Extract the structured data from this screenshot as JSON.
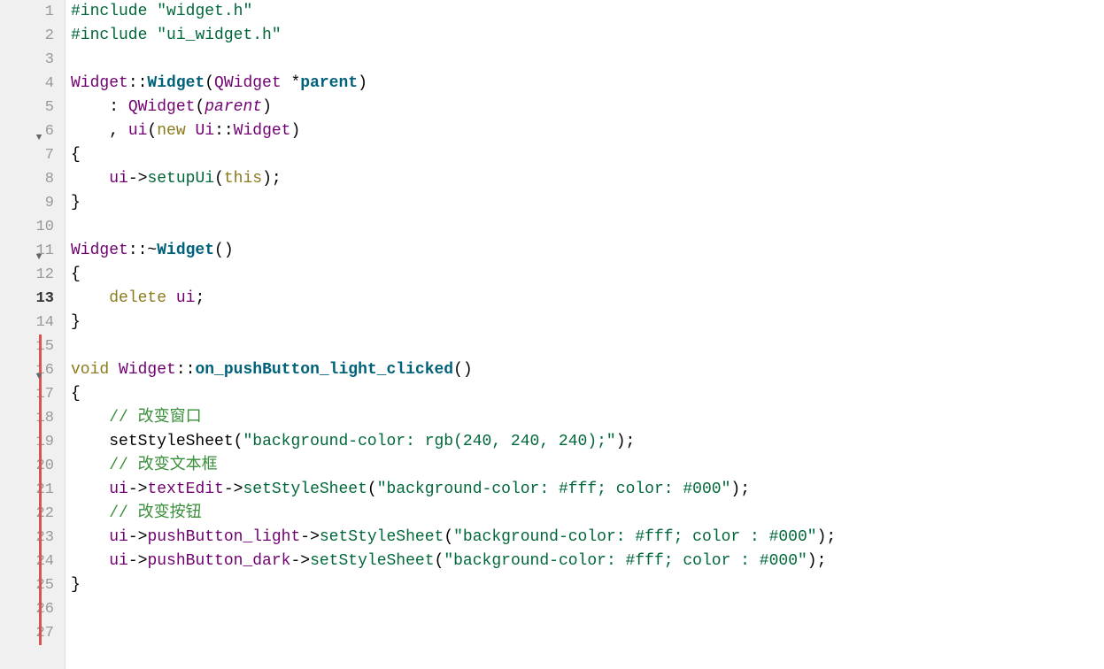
{
  "editor": {
    "current_line": 13,
    "lines": [
      {
        "num": 1,
        "tokens": [
          {
            "t": "#include",
            "c": "pp"
          },
          {
            "t": " "
          },
          {
            "t": "\"widget.h\"",
            "c": "str"
          }
        ]
      },
      {
        "num": 2,
        "tokens": [
          {
            "t": "#include",
            "c": "pp"
          },
          {
            "t": " "
          },
          {
            "t": "\"ui_widget.h\"",
            "c": "str"
          }
        ]
      },
      {
        "num": 3,
        "tokens": []
      },
      {
        "num": 4,
        "tokens": [
          {
            "t": "Widget",
            "c": "type"
          },
          {
            "t": "::"
          },
          {
            "t": "Widget",
            "c": "fn"
          },
          {
            "t": "("
          },
          {
            "t": "QWidget",
            "c": "type"
          },
          {
            "t": " *"
          },
          {
            "t": "parent",
            "c": "fn"
          },
          {
            "t": ")"
          }
        ]
      },
      {
        "num": 5,
        "tokens": [
          {
            "t": "    : "
          },
          {
            "t": "QWidget",
            "c": "type"
          },
          {
            "t": "("
          },
          {
            "t": "parent",
            "c": "param"
          },
          {
            "t": ")"
          }
        ]
      },
      {
        "num": 6,
        "fold": true,
        "tokens": [
          {
            "t": "    , "
          },
          {
            "t": "ui",
            "c": "id"
          },
          {
            "t": "("
          },
          {
            "t": "new",
            "c": "kw"
          },
          {
            "t": " "
          },
          {
            "t": "Ui",
            "c": "type"
          },
          {
            "t": "::"
          },
          {
            "t": "Widget",
            "c": "type"
          },
          {
            "t": ")"
          }
        ]
      },
      {
        "num": 7,
        "tokens": [
          {
            "t": "{"
          }
        ]
      },
      {
        "num": 8,
        "tokens": [
          {
            "t": "    "
          },
          {
            "t": "ui",
            "c": "id"
          },
          {
            "t": "->"
          },
          {
            "t": "setupUi",
            "c": "method"
          },
          {
            "t": "("
          },
          {
            "t": "this",
            "c": "kw"
          },
          {
            "t": ");"
          }
        ]
      },
      {
        "num": 9,
        "tokens": [
          {
            "t": "}"
          }
        ]
      },
      {
        "num": 10,
        "tokens": []
      },
      {
        "num": 11,
        "fold": true,
        "tokens": [
          {
            "t": "Widget",
            "c": "type"
          },
          {
            "t": "::~"
          },
          {
            "t": "Widget",
            "c": "fn"
          },
          {
            "t": "()"
          }
        ]
      },
      {
        "num": 12,
        "tokens": [
          {
            "t": "{"
          }
        ]
      },
      {
        "num": 13,
        "current": true,
        "tokens": [
          {
            "t": "    "
          },
          {
            "t": "delete",
            "c": "kw"
          },
          {
            "t": " "
          },
          {
            "t": "ui",
            "c": "id"
          },
          {
            "t": ";"
          }
        ]
      },
      {
        "num": 14,
        "tokens": [
          {
            "t": "}"
          }
        ]
      },
      {
        "num": 15,
        "changed": true,
        "tokens": []
      },
      {
        "num": 16,
        "changed": true,
        "fold": true,
        "tokens": [
          {
            "t": "void",
            "c": "kw"
          },
          {
            "t": " "
          },
          {
            "t": "Widget",
            "c": "type"
          },
          {
            "t": "::"
          },
          {
            "t": "on_pushButton_light_clicked",
            "c": "fn"
          },
          {
            "t": "()"
          }
        ]
      },
      {
        "num": 17,
        "changed": true,
        "tokens": [
          {
            "t": "{"
          }
        ]
      },
      {
        "num": 18,
        "changed": true,
        "tokens": [
          {
            "t": "    "
          },
          {
            "t": "// 改变窗口",
            "c": "comment"
          }
        ]
      },
      {
        "num": 19,
        "changed": true,
        "tokens": [
          {
            "t": "    "
          },
          {
            "t": "setStyleSheet"
          },
          {
            "t": "("
          },
          {
            "t": "\"background-color: rgb(240, 240, 240);\"",
            "c": "str"
          },
          {
            "t": ");"
          }
        ]
      },
      {
        "num": 20,
        "changed": true,
        "tokens": [
          {
            "t": "    "
          },
          {
            "t": "// 改变文本框",
            "c": "comment"
          }
        ]
      },
      {
        "num": 21,
        "changed": true,
        "tokens": [
          {
            "t": "    "
          },
          {
            "t": "ui",
            "c": "id"
          },
          {
            "t": "->"
          },
          {
            "t": "textEdit",
            "c": "id"
          },
          {
            "t": "->"
          },
          {
            "t": "setStyleSheet",
            "c": "method"
          },
          {
            "t": "("
          },
          {
            "t": "\"background-color: #fff; color: #000\"",
            "c": "str"
          },
          {
            "t": ");"
          }
        ]
      },
      {
        "num": 22,
        "changed": true,
        "tokens": [
          {
            "t": "    "
          },
          {
            "t": "// 改变按钮",
            "c": "comment"
          }
        ]
      },
      {
        "num": 23,
        "changed": true,
        "tokens": [
          {
            "t": "    "
          },
          {
            "t": "ui",
            "c": "id"
          },
          {
            "t": "->"
          },
          {
            "t": "pushButton_light",
            "c": "id"
          },
          {
            "t": "->"
          },
          {
            "t": "setStyleSheet",
            "c": "method"
          },
          {
            "t": "("
          },
          {
            "t": "\"background-color: #fff; color : #000\"",
            "c": "str"
          },
          {
            "t": ");"
          }
        ]
      },
      {
        "num": 24,
        "changed": true,
        "tokens": [
          {
            "t": "    "
          },
          {
            "t": "ui",
            "c": "id"
          },
          {
            "t": "->"
          },
          {
            "t": "pushButton_dark",
            "c": "id"
          },
          {
            "t": "->"
          },
          {
            "t": "setStyleSheet",
            "c": "method"
          },
          {
            "t": "("
          },
          {
            "t": "\"background-color: #fff; color : #000\"",
            "c": "str"
          },
          {
            "t": ");"
          }
        ]
      },
      {
        "num": 25,
        "changed": true,
        "tokens": [
          {
            "t": "}"
          }
        ]
      },
      {
        "num": 26,
        "changed": true,
        "tokens": []
      },
      {
        "num": 27,
        "changed": true,
        "tokens": []
      }
    ]
  }
}
